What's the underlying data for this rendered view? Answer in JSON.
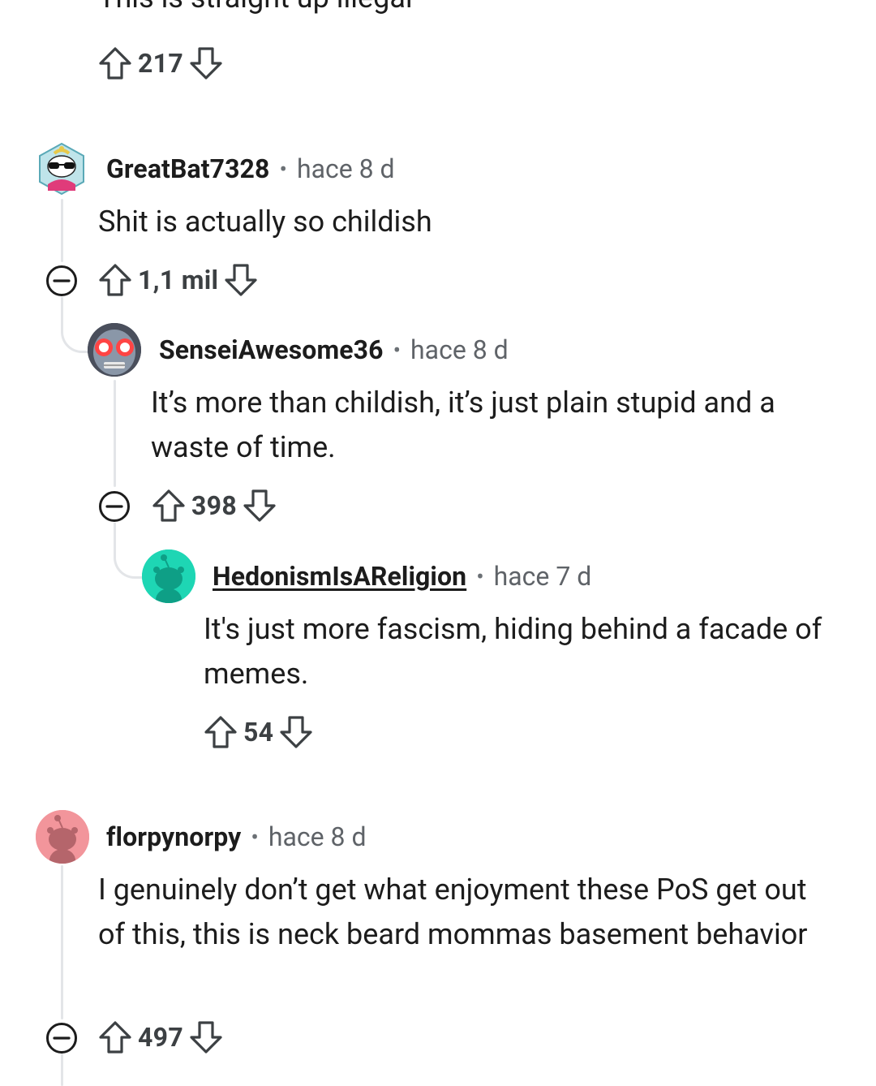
{
  "top_comment": {
    "text": "This is straight up illegal",
    "votes": "217",
    "icons": {
      "upvote": "arrow-up-outline-icon",
      "downvote": "arrow-down-outline-icon"
    }
  },
  "comments": [
    {
      "username": "GreatBat7328",
      "separator": "•",
      "time": "hace 8 d",
      "text": "Shit is actually so childish",
      "votes": "1,1 mil",
      "avatar": "snoo-sunglasses-hex-avatar"
    },
    {
      "username": "SenseiAwesome36",
      "separator": "•",
      "time": "hace 8 d",
      "text": "It’s more than childish, it’s just plain stupid and a waste of time.",
      "votes": "398",
      "avatar": "red-eyes-face-avatar"
    },
    {
      "username": "HedonismIsAReligion",
      "separator": "•",
      "time": "hace 7 d",
      "text": "It's just more fascism, hiding behind a facade of memes.",
      "votes": "54",
      "avatar": "default-snoo-teal-avatar"
    },
    {
      "username": "florpynorpy",
      "separator": "•",
      "time": "hace 8 d",
      "text": "I genuinely don’t get what enjoyment these PoS get out of this, this is neck beard mommas basement behavior",
      "votes": "497",
      "avatar": "default-snoo-pink-avatar"
    }
  ],
  "colors": {
    "thread_line": "#e3e5e8",
    "meta_gray": "#5f6368",
    "teal_avatar": "#1ed6b4",
    "pink_avatar": "#f2959b"
  }
}
